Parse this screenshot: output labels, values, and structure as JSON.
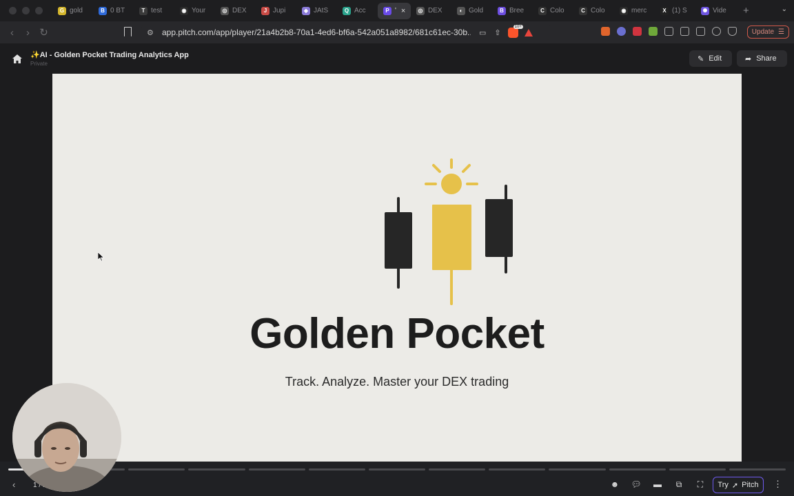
{
  "tabs": [
    {
      "label": "gold",
      "fav_color": "#d4b62c",
      "fav_glyph": "G"
    },
    {
      "label": "0 BT",
      "fav_color": "#2f6ad9",
      "fav_glyph": "B"
    },
    {
      "label": "test",
      "fav_color": "#3a3a3a",
      "fav_glyph": "T"
    },
    {
      "label": "Your",
      "fav_color": "#2b2b2b",
      "fav_glyph": "◉"
    },
    {
      "label": "DEX",
      "fav_color": "#555",
      "fav_glyph": "◎"
    },
    {
      "label": "Jupi",
      "fav_color": "#c94b46",
      "fav_glyph": "J"
    },
    {
      "label": "JAtS",
      "fav_color": "#8a7ad8",
      "fav_glyph": "◈"
    },
    {
      "label": "Acc",
      "fav_color": "#2aa38c",
      "fav_glyph": "Q"
    },
    {
      "label": "'",
      "fav_color": "#6a4be8",
      "fav_glyph": "P",
      "active": true
    },
    {
      "label": "DEX",
      "fav_color": "#555",
      "fav_glyph": "◎"
    },
    {
      "label": "Gold",
      "fav_color": "#555",
      "fav_glyph": "◐"
    },
    {
      "label": "Bree",
      "fav_color": "#6d4ee0",
      "fav_glyph": "B"
    },
    {
      "label": "Colo",
      "fav_color": "#333",
      "fav_glyph": "C"
    },
    {
      "label": "Colo",
      "fav_color": "#333",
      "fav_glyph": "C"
    },
    {
      "label": "merc",
      "fav_color": "#2b2b2b",
      "fav_glyph": "◉"
    },
    {
      "label": "(1) S",
      "fav_color": "#222",
      "fav_glyph": "X"
    },
    {
      "label": "Vide",
      "fav_color": "#6e55e0",
      "fav_glyph": "✺"
    }
  ],
  "browser": {
    "url": "app.pitch.com/app/player/21a4b2b8-70a1-4ed6-bf6a-542a051a8982/681c61ec-30b...",
    "brave_badge": "10+",
    "update_label": "Update"
  },
  "header": {
    "title": "✨AI - Golden Pocket Trading Analytics App",
    "visibility": "Private",
    "edit_label": "Edit",
    "share_label": "Share"
  },
  "slide": {
    "title": "Golden Pocket",
    "tagline": "Track. Analyze. Master your DEX trading",
    "accent_color": "#e6c14a",
    "dark_color": "#262626",
    "background": "#ecebe7"
  },
  "footer": {
    "slide_count": "1 / 1",
    "try_label": "Try",
    "pitch_label": "Pitch",
    "progress_segments": 13,
    "progress_done": 1
  }
}
